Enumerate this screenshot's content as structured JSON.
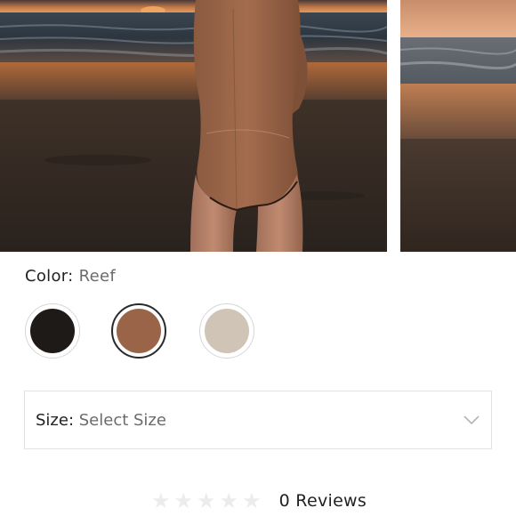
{
  "product": {
    "color": {
      "label": "Color:",
      "selected_value": "Reef",
      "swatches": [
        {
          "name": "Black",
          "hex": "#1e1a17"
        },
        {
          "name": "Reef",
          "hex": "#9a6448"
        },
        {
          "name": "Sand",
          "hex": "#cfc4b6"
        }
      ]
    },
    "size": {
      "label": "Size:",
      "value": "Select Size"
    },
    "reviews": {
      "count_text": "0 Reviews",
      "stars_filled": 0,
      "stars_total": 5
    }
  }
}
